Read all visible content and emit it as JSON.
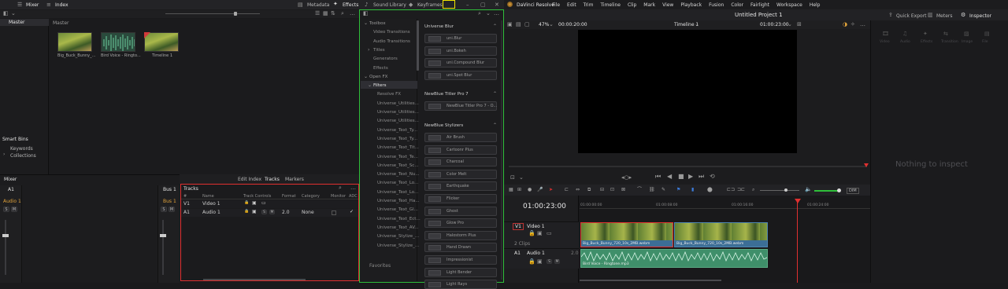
{
  "top_left_bar": {
    "mixer": "Mixer",
    "index": "Index",
    "metadata": "Metadata",
    "effects": "Effects",
    "sound_library": "Sound Library",
    "keyframes": "Keyframes"
  },
  "os_menu": {
    "app_name": "DaVinci Resolve",
    "items": [
      "File",
      "Edit",
      "Trim",
      "Timeline",
      "Clip",
      "Mark",
      "View",
      "Playback",
      "Fusion",
      "Color",
      "Fairlight",
      "Workspace",
      "Help"
    ]
  },
  "project_title": "Untitled Project 1",
  "right_toolbar": {
    "quick_export": "Quick Export",
    "meters": "Meters",
    "inspector": "Inspector"
  },
  "inspector_tabs": [
    "Video",
    "Audio",
    "Effects",
    "Transition",
    "Image",
    "File"
  ],
  "inspector_empty": "Nothing to inspect",
  "media_pool": {
    "bin_header": "Master",
    "master_label": "Master",
    "clips": [
      {
        "name": "Big_Buck_Bunny_..."
      },
      {
        "name": "Bird Voice - Ringto..."
      },
      {
        "name": "Timeline 1"
      }
    ],
    "smart_bins": "Smart Bins",
    "smart_items": [
      "Keywords",
      "Collections"
    ]
  },
  "effects_panel": {
    "tree": [
      {
        "label": "Toolbox",
        "level": 0
      },
      {
        "label": "Video Transitions",
        "level": 1
      },
      {
        "label": "Audio Transitions",
        "level": 1
      },
      {
        "label": "Titles",
        "level": 1
      },
      {
        "label": "Generators",
        "level": 1
      },
      {
        "label": "Effects",
        "level": 1
      },
      {
        "label": "Open FX",
        "level": 0
      },
      {
        "label": "Filters",
        "level": 1
      },
      {
        "label": "Resolve FX",
        "level": 2
      },
      {
        "label": "Universe_Utilities...",
        "level": 2
      },
      {
        "label": "Universe_Utilities...",
        "level": 2
      },
      {
        "label": "Universe_Utilities...",
        "level": 2
      },
      {
        "label": "Universe_Text_Ty...",
        "level": 2
      },
      {
        "label": "Universe_Text_Ty...",
        "level": 2
      },
      {
        "label": "Universe_Text_Tit...",
        "level": 2
      },
      {
        "label": "Universe_Text_Te...",
        "level": 2
      },
      {
        "label": "Universe_Text_Sc...",
        "level": 2
      },
      {
        "label": "Universe_Text_Nu...",
        "level": 2
      },
      {
        "label": "Universe_Text_Lo...",
        "level": 2
      },
      {
        "label": "Universe_Text_Lo...",
        "level": 2
      },
      {
        "label": "Universe_Text_Ha...",
        "level": 2
      },
      {
        "label": "Universe_Text_Gl...",
        "level": 2
      },
      {
        "label": "Universe_Text_Ect...",
        "level": 2
      },
      {
        "label": "Universe_Text_AV...",
        "level": 2
      },
      {
        "label": "Universe_Stylize_...",
        "level": 2
      },
      {
        "label": "Universe_Stylize_...",
        "level": 2
      }
    ],
    "favorites": "Favorites",
    "groups": [
      {
        "title": "Universe Blur",
        "items": [
          "uni.Blur",
          "uni.Bokeh",
          "uni.Compound Blur",
          "uni.Spot Blur"
        ]
      },
      {
        "title": "NewBlue Titler Pro 7",
        "items": [
          "NewBlue Titler Pro 7 - O..."
        ]
      },
      {
        "title": "NewBlue Stylizers",
        "items": [
          "Air Brush",
          "Cartoonr Plus",
          "Charcoal",
          "Color Melt",
          "Earthquake",
          "Flicker",
          "Ghost",
          "Glow Pro",
          "Halostorm Plus",
          "Hand Drawn",
          "Impressionist",
          "Light Bender",
          "Light Rays"
        ]
      }
    ]
  },
  "viewer": {
    "zoom": "47%",
    "src_timecode": "00:00:20:00",
    "timeline_name": "Timeline 1",
    "rec_timecode": "01:00:23:00"
  },
  "timeline": {
    "timecode": "01:00:23:00",
    "ruler": [
      "01:00:00:00",
      "01:00:08:00",
      "01:00:16:00",
      "01:00:24:00"
    ],
    "v1": {
      "tag": "V1",
      "name": "Video 1",
      "clips_count": "2 Clips",
      "clip_names": [
        "Big_Buck_Bunny_720_10s_2MB.webm",
        "Big_Buck_Bunny_720_10s_2MB.webm"
      ]
    },
    "a1": {
      "tag": "A1",
      "name": "Audio 1",
      "level": "2.0",
      "clip_name": "Bird Voice - Ringtone.mp3"
    },
    "dim": "DIM"
  },
  "mixer_panel": {
    "title": "Mixer",
    "a1": "A1",
    "audio1": "Audio 1",
    "bus1": "Bus 1",
    "s": "S",
    "m": "M"
  },
  "bottom_tabs": {
    "edit_index": "Edit Index",
    "tracks": "Tracks",
    "markers": "Markers"
  },
  "tracks_panel": {
    "title": "Tracks",
    "columns": [
      "#",
      "Name",
      "Track Controls",
      "Format",
      "Category",
      "Monitor",
      "ADC"
    ],
    "rows": [
      {
        "id": "V1",
        "name": "Video 1",
        "format": "",
        "category": ""
      },
      {
        "id": "A1",
        "name": "Audio 1",
        "format": "2.0",
        "category": "None"
      }
    ]
  },
  "colors": {
    "highlight_red": "#e03030",
    "highlight_green": "#2fbf3a",
    "highlight_yellow": "#f2e600",
    "video_clip": "#3c6e96",
    "audio_clip": "#3f8f6a",
    "accent_orange": "#e0a23a"
  }
}
